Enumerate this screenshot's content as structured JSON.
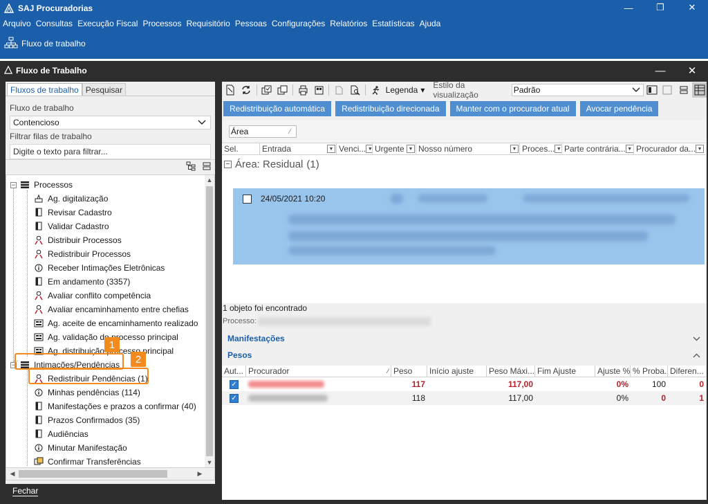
{
  "app": {
    "title": "SAJ Procuradorias",
    "window_controls": {
      "minimize": "—",
      "restore": "❐",
      "close": "✕"
    },
    "menu": [
      "Arquivo",
      "Consultas",
      "Execução Fiscal",
      "Processos",
      "Requisitório",
      "Pessoas",
      "Configurações",
      "Relatórios",
      "Estatísticas",
      "Ajuda"
    ],
    "quick_action": "Fluxo de trabalho"
  },
  "window": {
    "title": "Fluxo de Trabalho",
    "controls": {
      "minimize": "—",
      "close": "✕"
    }
  },
  "left": {
    "tabs": [
      "Fluxos de trabalho",
      "Pesquisar"
    ],
    "flow_label": "Fluxo de trabalho",
    "flow_value": "Contencioso",
    "filter_label": "Filtrar filas de trabalho",
    "filter_placeholder": "Digite o texto para filtrar...",
    "tree": {
      "processos": "Processos",
      "processos_items": [
        "Ag. digitalização",
        "Revisar Cadastro",
        "Validar Cadastro",
        "Distribuir Processos",
        "Redistribuir Processos",
        "Receber Intimações Eletrônicas",
        "Em andamento (3357)",
        "Avaliar conflito competência",
        "Avaliar encaminhamento entre chefias",
        "Ag. aceite de encaminhamento realizado",
        "Ag. validação do processo principal",
        "Ag. distribuição processo principal"
      ],
      "intimacoes": "Intimações/Pendências",
      "intimacoes_items": [
        "Redistribuir Pendências (1)",
        "Minhas pendências (114)",
        "Manifestações e prazos a confirmar (40)",
        "Prazos Confirmados (35)",
        "Audiências",
        "Minutar Manifestação",
        "Confirmar Transferências"
      ]
    },
    "close_button": "Fechar",
    "callouts": [
      "1",
      "2"
    ]
  },
  "right": {
    "legend_label": "Legenda",
    "style_label": "Estilo da visualização",
    "style_value": "Padrão",
    "actions": [
      "Redistribuição automática",
      "Redistribuição direcionada",
      "Manter com o procurador atual",
      "Avocar pendência"
    ],
    "group_chip": "Área",
    "columns": [
      "Sel.",
      "Entrada",
      "Venci...",
      "Urgente",
      "Nosso número",
      "Proces...",
      "Parte contrária...",
      "Procurador da..."
    ],
    "group_header": "Área: Residual",
    "group_count": "(1)",
    "row_date": "24/05/2021 10:20",
    "found_text": "1 objeto foi encontrado",
    "process_label": "Processo:",
    "sections": {
      "manifestacoes": "Manifestações",
      "pesos": "Pesos"
    },
    "pesos_columns": [
      "Aut...",
      "Procurador",
      "Peso",
      "Início ajuste",
      "Peso Máxi...",
      "Fim Ajuste",
      "Ajuste %",
      "% Proba...",
      "Diferen..."
    ],
    "pesos_rows": [
      {
        "peso": "117",
        "peso_max": "117,00",
        "ajuste": "0%",
        "prob": "100",
        "dif": "0"
      },
      {
        "peso": "118",
        "peso_max": "117,00",
        "ajuste": "0%",
        "prob": "0",
        "dif": "1"
      }
    ]
  },
  "colors": {
    "brand": "#1b5eaa",
    "button": "#4f8fd1",
    "selection": "#99c4ec",
    "callout": "#f28a1e",
    "alert": "#b22028"
  }
}
